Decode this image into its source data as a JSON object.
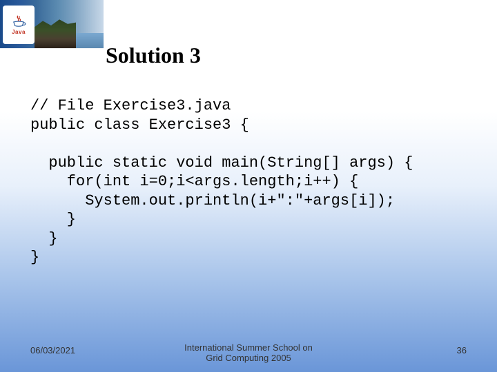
{
  "logo_text": "Java",
  "title": "Solution 3",
  "code": "// File Exercise3.java\npublic class Exercise3 {\n\n  public static void main(String[] args) {\n    for(int i=0;i<args.length;i++) {\n      System.out.println(i+\":\"+args[i]);\n    }\n  }\n}",
  "footer": {
    "date": "06/03/2021",
    "center_line1": "International Summer School on",
    "center_line2": "Grid Computing 2005",
    "page": "36"
  }
}
